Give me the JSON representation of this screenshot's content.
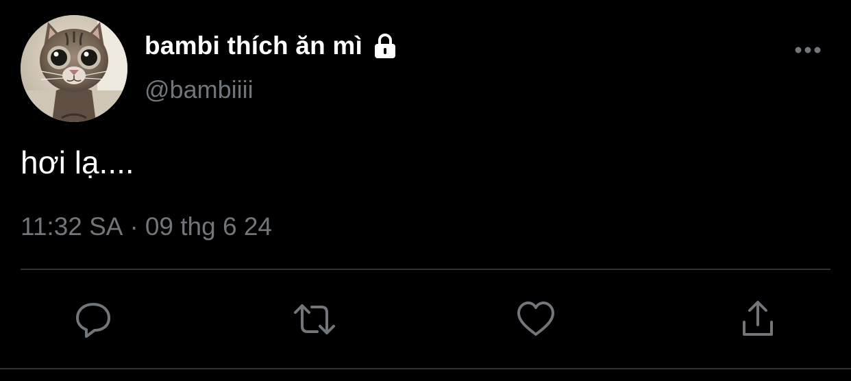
{
  "tweet": {
    "author": {
      "display_name": "bambi thích ăn mì",
      "handle": "@bambiiii",
      "protected_icon": "lock-icon",
      "avatar": "cat-photo"
    },
    "text": "hơi lạ....",
    "time": "11:32 SA",
    "separator": "·",
    "date": "09 thg 6 24",
    "more_icon": "more-dots-icon"
  },
  "actions": [
    {
      "name": "reply",
      "icon": "comment-icon"
    },
    {
      "name": "retweet",
      "icon": "retweet-icon"
    },
    {
      "name": "like",
      "icon": "heart-icon"
    },
    {
      "name": "share",
      "icon": "share-icon"
    }
  ],
  "colors": {
    "background": "#000000",
    "primary_text": "#ffffff",
    "secondary_text": "#71767b",
    "divider": "#2f3336"
  }
}
